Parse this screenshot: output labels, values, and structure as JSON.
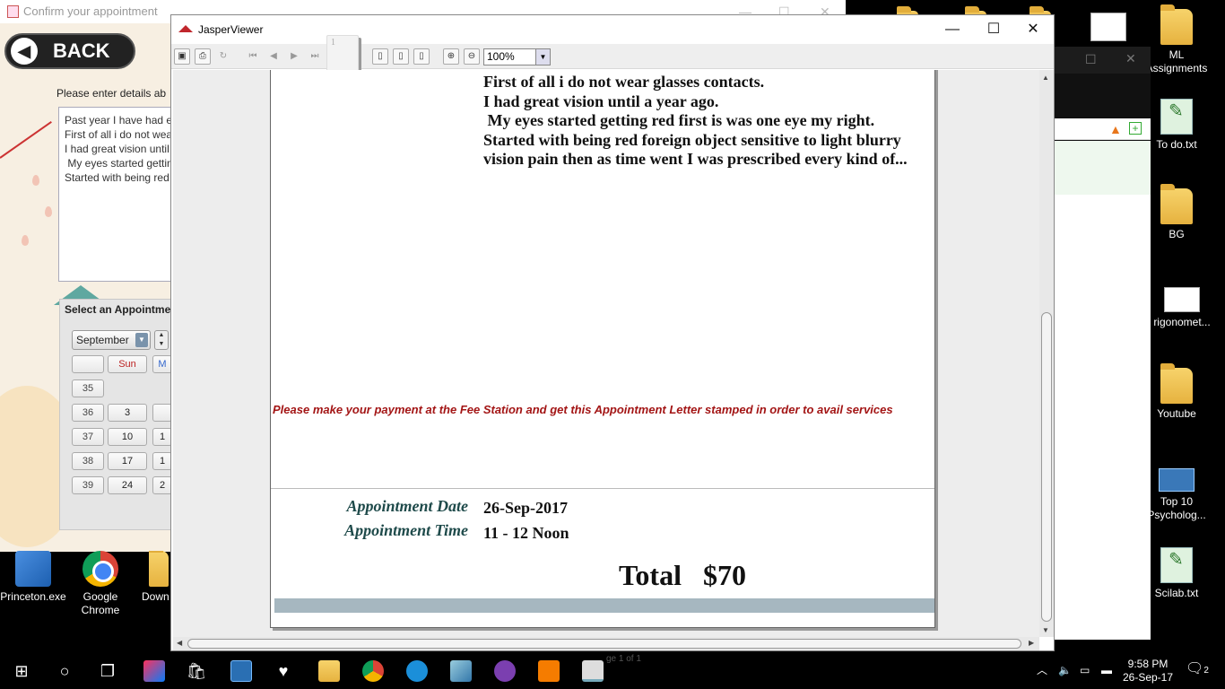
{
  "background_window": {
    "title": "Confirm your appointment",
    "back_label": "BACK",
    "details_label": "Please enter details ab",
    "details_lines": [
      "Past year I have had e",
      "First of all i do not wea",
      "I had great vision until",
      " My eyes started gettin",
      "Started with being red"
    ],
    "appointment_label": "Select an Appointmen",
    "month": "September",
    "day_headers": [
      "Sun",
      "M"
    ],
    "week_numbers": [
      "35",
      "36",
      "37",
      "38",
      "39"
    ],
    "sunday_dates": [
      "3",
      "10",
      "17",
      "24"
    ],
    "partial_dates": [
      "1",
      "1",
      "2"
    ]
  },
  "desktop_icons_left": [
    {
      "label": "Princeton.exe",
      "icon": "installer-icon"
    },
    {
      "label": "Google Chrome",
      "icon": "chrome-icon"
    },
    {
      "label": "Down",
      "icon": "folder-icon"
    }
  ],
  "desktop_icons_right": [
    {
      "label": "ML Assignments",
      "icon": "folder-icon"
    },
    {
      "label": "To do.txt",
      "icon": "scilab-file-icon"
    },
    {
      "label": "BG",
      "icon": "folder-icon"
    },
    {
      "label": "rigonomet...",
      "icon": "image-file-icon"
    },
    {
      "label": "Youtube",
      "icon": "folder-icon"
    },
    {
      "label": "Top 10 Psycholog...",
      "icon": "video-file-icon"
    },
    {
      "label": "Scilab.txt",
      "icon": "scilab-file-icon"
    }
  ],
  "jasper": {
    "title": "JasperViewer",
    "page_input": "1",
    "zoom": "100%",
    "status": "ge 1 of 1",
    "report": {
      "description_lines": [
        "First of all i do not wear glasses contacts.",
        "I had great vision until a year ago.",
        " My eyes started getting red first is was one eye my right.",
        "Started with being red foreign object sensitive to light blurry",
        "vision pain then as time went I was prescribed every kind of..."
      ],
      "payment_note": "Please make your payment at the Fee Station and get this Appointment Letter stamped in order to avail services",
      "date_label": "Appointment Date",
      "date_value": "26-Sep-2017",
      "time_label": "Appointment Time",
      "time_value": "11 - 12 Noon",
      "total": "Total   $70"
    }
  },
  "taskbar": {
    "time": "9:58 PM",
    "date": "26-Sep-17",
    "notifications": "2"
  },
  "colors": {
    "payment_note": "#a31515",
    "labels": "#1e4a4a",
    "footer_band": "#a6b7c0"
  }
}
